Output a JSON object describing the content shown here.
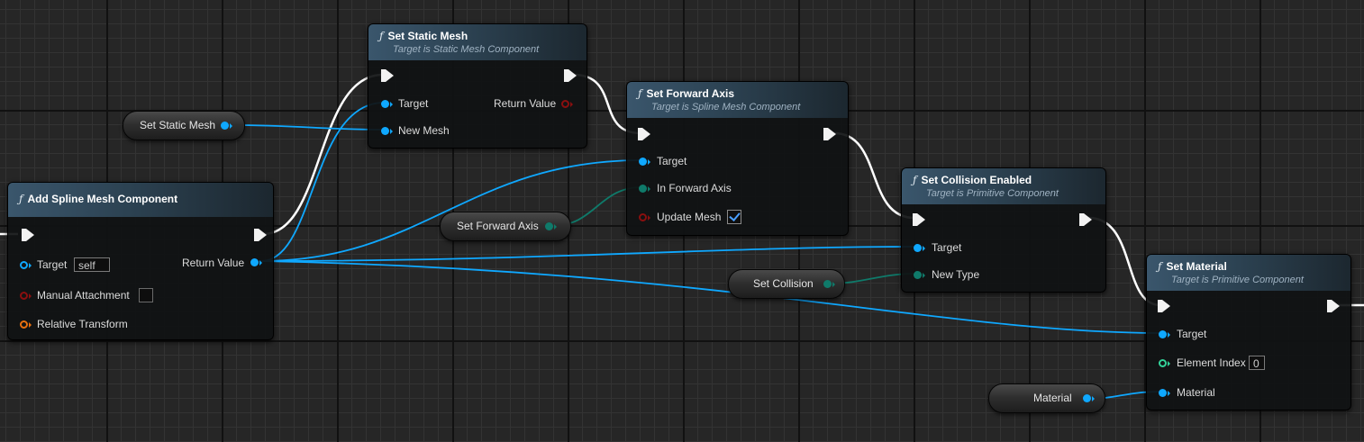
{
  "colors": {
    "object_pin": "#0fa8ff",
    "enum_pin": "#0f7a6a",
    "bool_pin": "#8a0f0f",
    "struct_pin": "#e8700f",
    "int_pin": "#33d39a",
    "exec_wire": "#ffffff",
    "header_gradient_start": "#3a566c"
  },
  "nodes": {
    "add_spline": {
      "title": "Add Spline Mesh Component",
      "icon": "function-icon",
      "pins": {
        "target": "Target",
        "target_value": "self",
        "manual_attachment": "Manual Attachment",
        "relative_transform": "Relative Transform",
        "return_value": "Return Value"
      }
    },
    "set_static_mesh": {
      "title": "Set Static Mesh",
      "subtitle": "Target is Static Mesh Component",
      "icon": "function-icon",
      "pins": {
        "target": "Target",
        "new_mesh": "New Mesh",
        "return_value": "Return Value"
      }
    },
    "set_forward_axis": {
      "title": "Set Forward Axis",
      "subtitle": "Target is Spline Mesh Component",
      "icon": "function-icon",
      "pins": {
        "target": "Target",
        "in_forward_axis": "In Forward Axis",
        "update_mesh": "Update Mesh",
        "update_mesh_checked": true
      }
    },
    "set_collision": {
      "title": "Set Collision Enabled",
      "subtitle": "Target is Primitive Component",
      "icon": "function-icon",
      "pins": {
        "target": "Target",
        "new_type": "New Type"
      }
    },
    "set_material": {
      "title": "Set Material",
      "subtitle": "Target is Primitive Component",
      "icon": "function-icon",
      "pins": {
        "target": "Target",
        "element_index": "Element Index",
        "element_index_value": "0",
        "material": "Material"
      }
    }
  },
  "variables": {
    "static_mesh": "Set Static Mesh",
    "forward_axis": "Set Forward Axis",
    "collision": "Set Collision",
    "material": "Material"
  },
  "icons": {
    "function": "ƒ",
    "checkmark": "checkmark-icon"
  }
}
